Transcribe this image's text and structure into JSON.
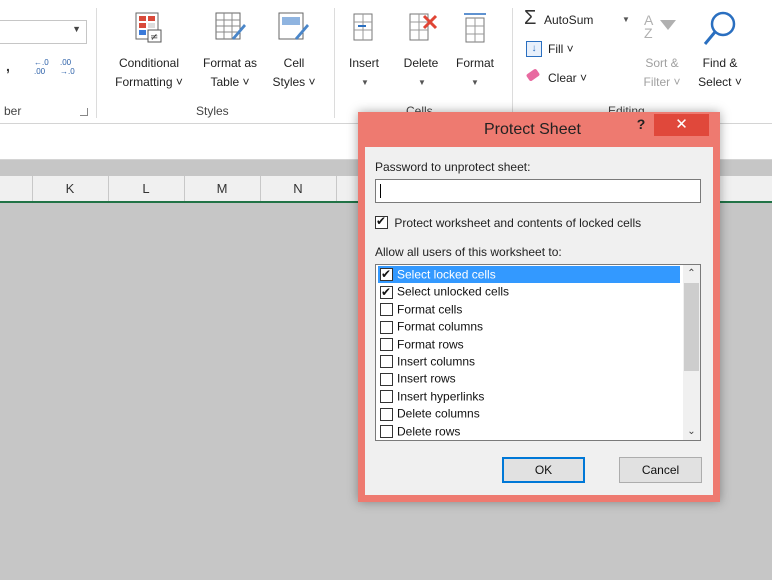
{
  "ribbon": {
    "number": {
      "group_label": "ber",
      "comma_glyph": ",",
      "dec_increase": "←.0 .00",
      "dec_decrease": ".00 →.0"
    },
    "styles": {
      "group_label": "Styles",
      "cond_fmt_line1": "Conditional",
      "cond_fmt_line2": "Formatting ˅",
      "fmt_table_line1": "Format as",
      "fmt_table_line2": "Table ˅",
      "cell_styles_line1": "Cell",
      "cell_styles_line2": "Styles ˅"
    },
    "cells": {
      "group_label": "Cells",
      "insert_label": "Insert",
      "delete_label": "Delete",
      "format_label": "Format"
    },
    "editing": {
      "group_label": "Editing",
      "autosum_label": "AutoSum",
      "fill_label": "Fill ˅",
      "clear_label": "Clear ˅",
      "sort_line1": "Sort &",
      "sort_line2": "Filter ˅",
      "find_line1": "Find &",
      "find_line2": "Select ˅"
    }
  },
  "columns": [
    "K",
    "L",
    "M",
    "N"
  ],
  "dialog": {
    "title": "Protect Sheet",
    "help": "?",
    "close": "✕",
    "password_label": "Password to unprotect sheet:",
    "password_value": "",
    "protect_label": "Protect worksheet and contents of locked cells",
    "protect_checked": true,
    "allow_label": "Allow all users of this worksheet to:",
    "permissions": [
      {
        "label": "Select locked cells",
        "checked": true,
        "selected": true
      },
      {
        "label": "Select unlocked cells",
        "checked": true,
        "selected": false
      },
      {
        "label": "Format cells",
        "checked": false,
        "selected": false
      },
      {
        "label": "Format columns",
        "checked": false,
        "selected": false
      },
      {
        "label": "Format rows",
        "checked": false,
        "selected": false
      },
      {
        "label": "Insert columns",
        "checked": false,
        "selected": false
      },
      {
        "label": "Insert rows",
        "checked": false,
        "selected": false
      },
      {
        "label": "Insert hyperlinks",
        "checked": false,
        "selected": false
      },
      {
        "label": "Delete columns",
        "checked": false,
        "selected": false
      },
      {
        "label": "Delete rows",
        "checked": false,
        "selected": false
      }
    ],
    "ok_label": "OK",
    "cancel_label": "Cancel"
  },
  "colors": {
    "dialog_frame": "#ee7a70",
    "close_button": "#e0483b",
    "selection": "#3399ff",
    "header_accent": "#217346"
  }
}
